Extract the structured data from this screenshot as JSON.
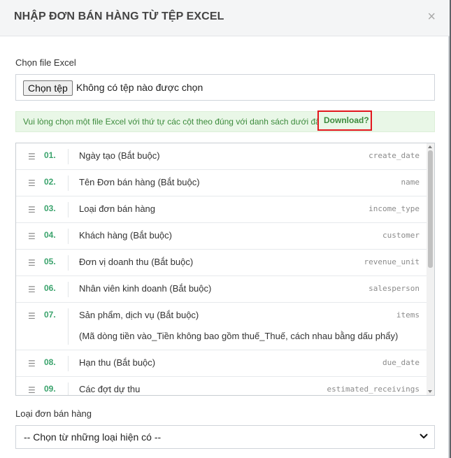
{
  "header": {
    "title": "NHẬP ĐƠN BÁN HÀNG TỪ TỆP EXCEL",
    "close": "×"
  },
  "file": {
    "label": "Chọn file Excel",
    "button": "Chọn tệp",
    "status": "Không có tệp nào được chọn"
  },
  "alert": {
    "text": "Vui lòng chọn một file Excel với thứ tự các cột theo đúng với danh sách dưới đây.",
    "download": "Download?"
  },
  "columns": [
    {
      "num": "01.",
      "label": "Ngày tạo (Bắt buộc)",
      "key": "create_date"
    },
    {
      "num": "02.",
      "label": "Tên Đơn bán hàng (Bắt buộc)",
      "key": "name"
    },
    {
      "num": "03.",
      "label": "Loại đơn bán hàng",
      "key": "income_type"
    },
    {
      "num": "04.",
      "label": "Khách hàng (Bắt buộc)",
      "key": "customer"
    },
    {
      "num": "05.",
      "label": "Đơn vị doanh thu (Bắt buộc)",
      "key": "revenue_unit"
    },
    {
      "num": "06.",
      "label": "Nhân viên kinh doanh (Bắt buộc)",
      "key": "salesperson"
    },
    {
      "num": "07.",
      "label": "Sản phẩm, dịch vụ (Bắt buộc)",
      "sub": "(Mã dòng tiền vào_Tiền không bao gồm thuế_Thuế, cách nhau bằng dấu phẩy)",
      "key": "items"
    },
    {
      "num": "08.",
      "label": "Hạn thu (Bắt buộc)",
      "key": "due_date"
    },
    {
      "num": "09.",
      "label": "Các đợt dự thu",
      "key": "estimated_receivings"
    }
  ],
  "type_select": {
    "label": "Loại đơn bán hàng",
    "value": "-- Chọn từ những loại hiện có --"
  }
}
